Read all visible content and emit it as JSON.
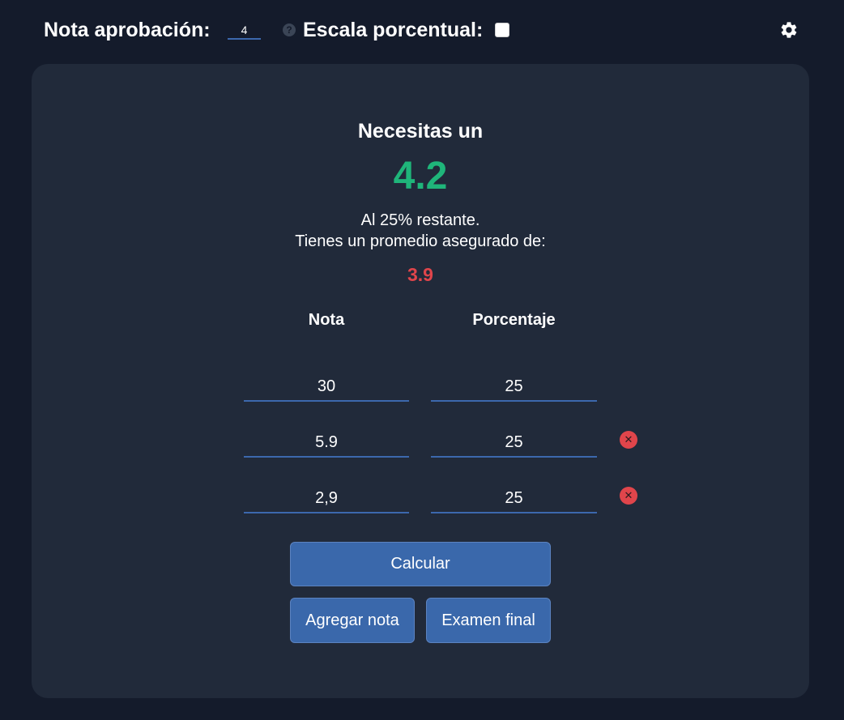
{
  "topbar": {
    "approval_label": "Nota aprobación:",
    "approval_value": "4",
    "help_icon": "question-circle-icon",
    "scale_label": "Escala porcentual:",
    "scale_checked": false,
    "settings_icon": "gear-icon"
  },
  "result": {
    "title": "Necesitas un",
    "needed_grade": "4.2",
    "remaining_text": "Al 25% restante.",
    "average_text": "Tienes un promedio asegurado de:",
    "average_value": "3.9",
    "needed_color": "#1fb57a",
    "average_color": "#e0454b"
  },
  "table": {
    "headers": {
      "grade": "Nota",
      "percent": "Porcentaje"
    },
    "rows": [
      {
        "grade": "30",
        "percent": "25",
        "removable": false
      },
      {
        "grade": "5.9",
        "percent": "25",
        "removable": true
      },
      {
        "grade": "2,9",
        "percent": "25",
        "removable": true
      }
    ],
    "remove_icon": "close-circle-icon"
  },
  "buttons": {
    "calculate": "Calcular",
    "add_grade": "Agregar nota",
    "final_exam": "Examen final"
  },
  "colors": {
    "background": "#141b2b",
    "card": "#212a3a",
    "accent": "#3a68ab",
    "danger": "#e0454b",
    "success": "#1fb57a"
  }
}
